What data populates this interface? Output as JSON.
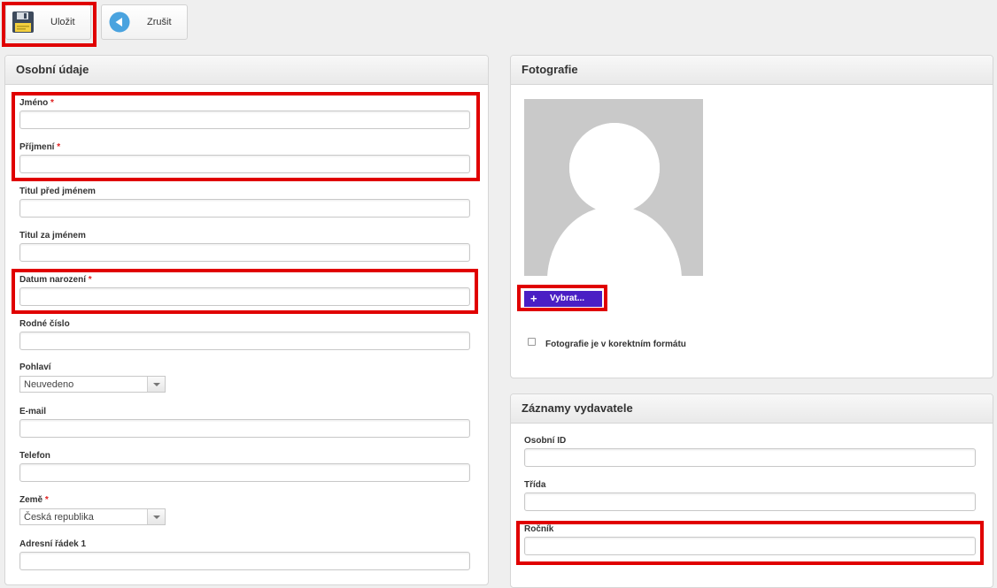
{
  "toolbar": {
    "save_label": "Uložit",
    "cancel_label": "Zrušit"
  },
  "personal": {
    "title": "Osobní údaje",
    "fields": {
      "jmeno": "Jméno",
      "prijmeni": "Příjmení",
      "titul_pred": "Titul před jménem",
      "titul_za": "Titul za jménem",
      "datum": "Datum narození",
      "rodne_cislo": "Rodné číslo",
      "pohlavi": "Pohlaví",
      "email": "E-mail",
      "telefon": "Telefon",
      "zeme": "Země",
      "adresni": "Adresní řádek 1"
    },
    "required_mark": "*",
    "pohlavi_value": "Neuvedeno",
    "zeme_value": "Česká republika"
  },
  "photo": {
    "title": "Fotografie",
    "choose_label": "Vybrat...",
    "checkbox_label": "Fotografie je v korektním formátu"
  },
  "publisher": {
    "title": "Záznamy vydavatele",
    "fields": {
      "osobni_id": "Osobní ID",
      "trida": "Třída",
      "rocnik": "Ročník"
    }
  },
  "colors": {
    "highlight": "#e00000",
    "choose_button": "#4a1fc4",
    "required": "#e02020"
  }
}
